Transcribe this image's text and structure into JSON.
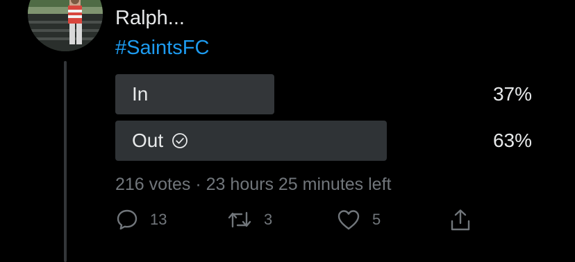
{
  "tweet": {
    "author_name": "Ralph...",
    "hashtag": "#SaintsFC",
    "avatar": {
      "icon": "profile-photo-avatar"
    }
  },
  "poll": {
    "options": [
      {
        "label": "In",
        "percent_label": "37%",
        "percent": 37,
        "selected": false
      },
      {
        "label": "Out",
        "percent_label": "63%",
        "percent": 63,
        "selected": true,
        "winner_icon": "check-circle-icon"
      }
    ],
    "votes": "216 votes",
    "separator": "·",
    "time_left": "23 hours 25 minutes left"
  },
  "actions": {
    "reply": {
      "icon": "reply-icon",
      "count": "13"
    },
    "retweet": {
      "icon": "retweet-icon",
      "count": "3"
    },
    "like": {
      "icon": "heart-icon",
      "count": "5"
    },
    "share": {
      "icon": "share-icon"
    }
  },
  "colors": {
    "background": "#000000",
    "text": "#e7e9ea",
    "muted": "#71767b",
    "link": "#1d9bf0",
    "poll_bar": "#333639"
  }
}
